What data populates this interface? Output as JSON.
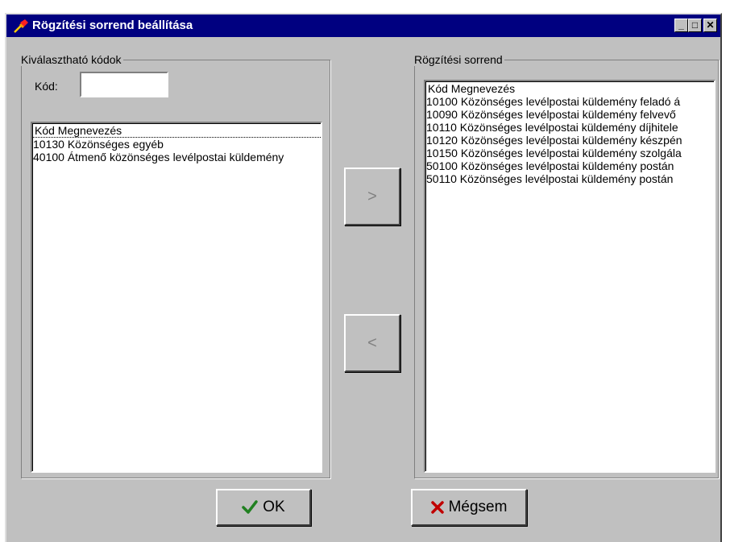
{
  "window": {
    "title": "Rögzítési sorrend beállítása",
    "minimize": "_",
    "maximize": "□",
    "close": "✕"
  },
  "left": {
    "group_title": "Kiválasztható kódok",
    "kod_label": "Kód:",
    "kod_value": "",
    "header": "Kód   Megnevezés",
    "items": [
      "10130 Közönséges egyéb",
      "40100 Átmenő közönséges levélpostai küldemény"
    ]
  },
  "transfer": {
    "add_label": ">",
    "remove_label": "<"
  },
  "right": {
    "group_title": "Rögzítési sorrend",
    "header": "Kód   Megnevezés",
    "items": [
      "10100 Közönséges levélpostai küldemény feladó á",
      "10090 Közönséges levélpostai küldemény felvevő",
      "10110 Közönséges levélpostai küldemény díjhitele",
      "10120 Közönséges levélpostai küldemény készpén",
      "10150 Közönséges levélpostai küldemény szolgála",
      "50100 Közönséges levélpostai küldemény postán",
      "50110 Közönséges levélpostai küldemény postán"
    ]
  },
  "buttons": {
    "ok_label": "OK",
    "cancel_label": "Mégsem"
  },
  "colors": {
    "titlebar": "#000080",
    "ok_check": "#208020",
    "cancel_x": "#c00000"
  }
}
